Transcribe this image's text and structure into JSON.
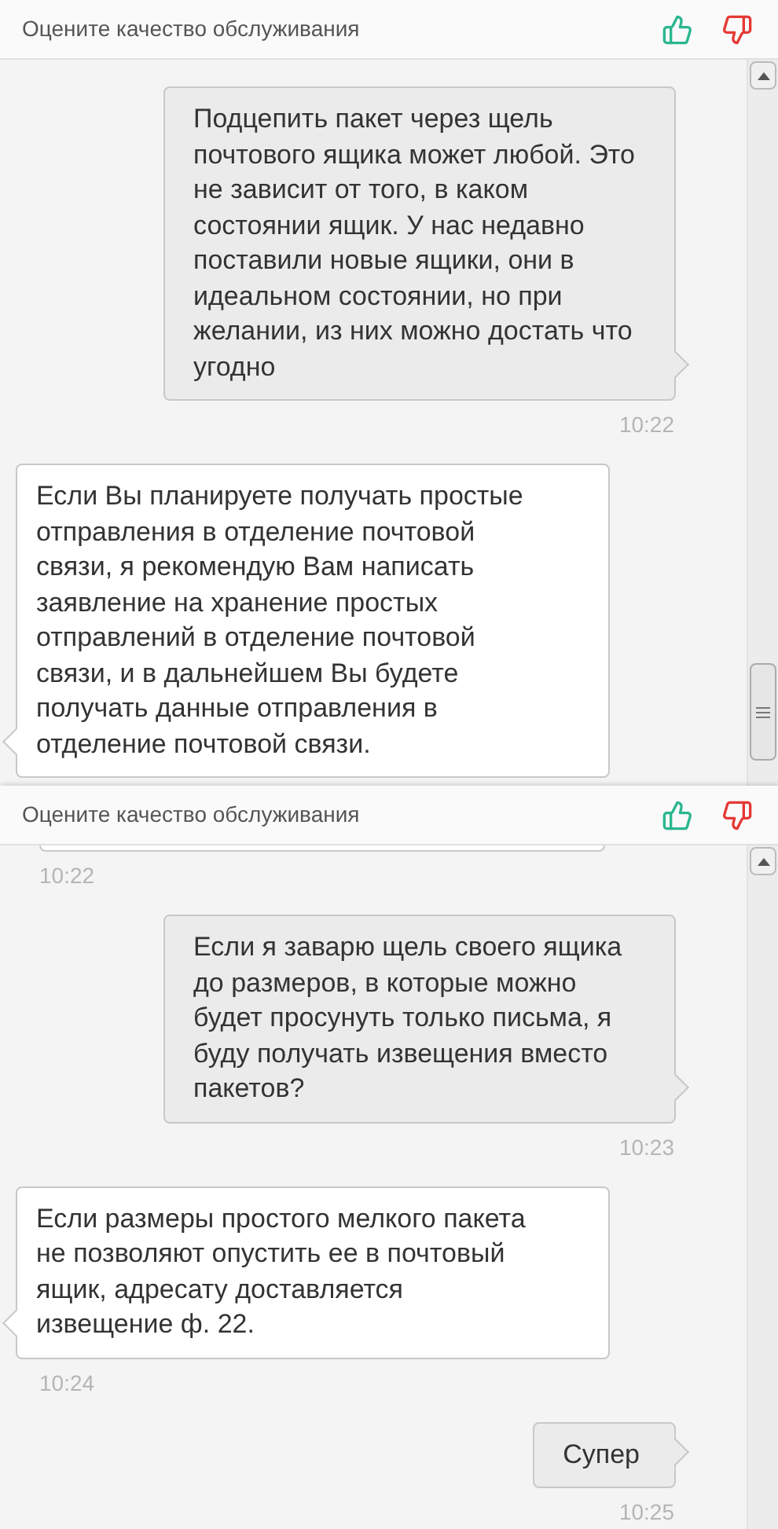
{
  "panels": [
    {
      "header": {
        "title": "Оцените качество обслуживания"
      },
      "messages": [
        {
          "kind": "outgoing",
          "text": "Подцепить пакет через щель почтового ящика может любой. Это не зависит от того, в каком состоянии ящик. У нас недавно поставили новые ящики, они в идеальном состоянии, но при желании, из них можно достать что угодно",
          "time": "10:22"
        },
        {
          "kind": "incoming",
          "text": "Если Вы планируете получать простые отправления в отделение почтовой связи, я рекомендую Вам написать заявление на хранение простых отправлений в отделение почтовой связи, и в дальнейшем Вы будете получать данные отправления в отделение почтовой связи."
        }
      ]
    },
    {
      "header": {
        "title": "Оцените качество обслуживания"
      },
      "messages": [
        {
          "kind": "incoming_cut",
          "time": "10:22"
        },
        {
          "kind": "outgoing",
          "text": "Если я заварю щель своего ящика до размеров, в которые можно будет просунуть только письма, я буду получать извещения вместо пакетов?",
          "time": "10:23"
        },
        {
          "kind": "incoming",
          "text": "Если размеры простого мелкого пакета не позволяют опустить ее в почтовый ящик, адресату доставляется извещение ф. 22.",
          "time": "10:24"
        },
        {
          "kind": "outgoing",
          "text": "Супер",
          "time": "10:25"
        }
      ]
    }
  ]
}
